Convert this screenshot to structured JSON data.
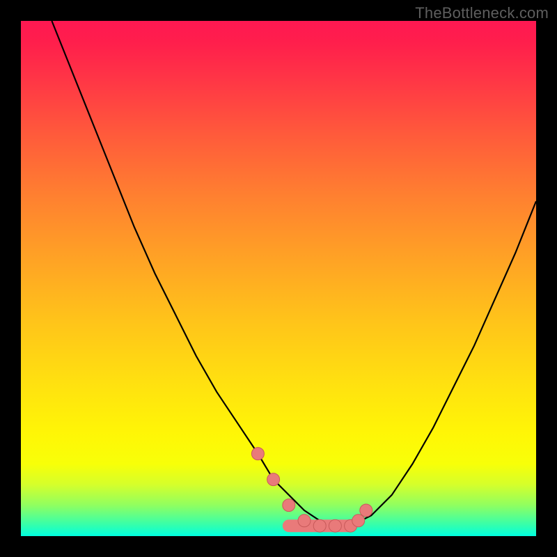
{
  "watermark": "TheBottleneck.com",
  "colors": {
    "frame_bg": "#000000",
    "curve_stroke": "#000000",
    "marker_fill": "#e97a7a",
    "marker_stroke": "#c85a5a"
  },
  "chart_data": {
    "type": "line",
    "title": "",
    "xlabel": "",
    "ylabel": "",
    "xlim": [
      0,
      100
    ],
    "ylim": [
      0,
      100
    ],
    "series": [
      {
        "name": "bottleneck-curve",
        "x": [
          6,
          10,
          14,
          18,
          22,
          26,
          30,
          34,
          38,
          42,
          46,
          49,
          52,
          55,
          58,
          60,
          62,
          64,
          68,
          72,
          76,
          80,
          84,
          88,
          92,
          96,
          100
        ],
        "y": [
          100,
          90,
          80,
          70,
          60,
          51,
          43,
          35,
          28,
          22,
          16,
          11,
          8,
          5,
          3,
          2,
          2,
          2,
          4,
          8,
          14,
          21,
          29,
          37,
          46,
          55,
          65
        ]
      }
    ],
    "markers": {
      "name": "highlighted-points",
      "x": [
        46,
        49,
        52,
        55,
        58,
        61,
        64,
        65.5,
        67
      ],
      "y": [
        16,
        11,
        6,
        3,
        2,
        2,
        2,
        3,
        5
      ]
    }
  }
}
